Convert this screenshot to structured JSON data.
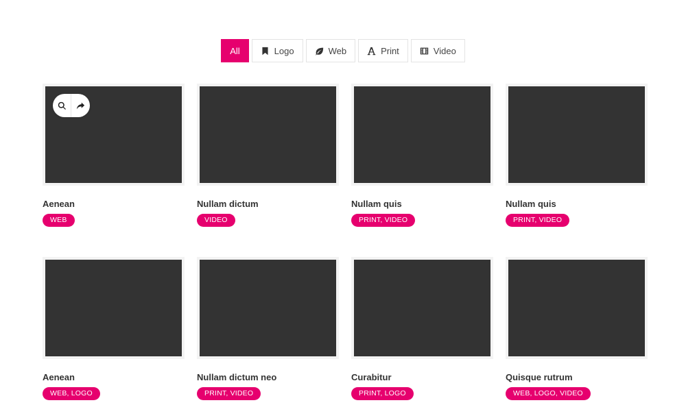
{
  "filters": [
    {
      "label": "All",
      "icon": "",
      "active": true
    },
    {
      "label": "Logo",
      "icon": "bookmark-icon",
      "active": false
    },
    {
      "label": "Web",
      "icon": "leaf-icon",
      "active": false
    },
    {
      "label": "Print",
      "icon": "font-icon",
      "active": false
    },
    {
      "label": "Video",
      "icon": "film-icon",
      "active": false
    }
  ],
  "overlay_icons": [
    "search-icon",
    "share-icon"
  ],
  "items": [
    {
      "title": "Aenean",
      "tags": "WEB"
    },
    {
      "title": "Nullam dictum",
      "tags": "VIDEO"
    },
    {
      "title": "Nullam quis",
      "tags": "PRINT, VIDEO"
    },
    {
      "title": "Nullam quis",
      "tags": "PRINT, VIDEO"
    },
    {
      "title": "Aenean",
      "tags": "WEB, LOGO"
    },
    {
      "title": "Nullam dictum neo",
      "tags": "PRINT, VIDEO"
    },
    {
      "title": "Curabitur",
      "tags": "PRINT, LOGO"
    },
    {
      "title": "Quisque rutrum",
      "tags": "WEB, LOGO, VIDEO"
    }
  ],
  "colors": {
    "accent": "#e6006e",
    "thumb": "#333333",
    "text": "#333333"
  }
}
